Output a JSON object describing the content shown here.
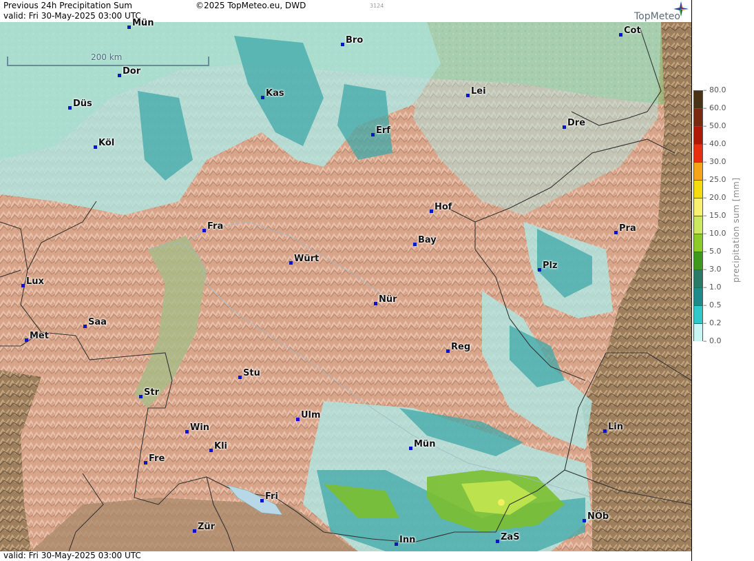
{
  "header": {
    "title": "Previous 24h Precipitation Sum",
    "valid": "valid:  Fri  30-May-2025 03:00 UTC",
    "copyright": "©2025 TopMeteo.eu, DWD",
    "code": "3124",
    "brand": "TopMeteo"
  },
  "footer": {
    "valid": "valid:  Fri  30-May-2025 03:00 UTC"
  },
  "scale": {
    "label": "200 km"
  },
  "legend": {
    "title": "precipitation sum  [mm]",
    "ticks": [
      "80.0",
      "60.0",
      "50.0",
      "40.0",
      "30.0",
      "25.0",
      "20.0",
      "15.0",
      "10.0",
      "5.0",
      "3.0",
      "1.0",
      "0.5",
      "0.2",
      "0.0"
    ],
    "colors": [
      "#4a3418",
      "#7a2a10",
      "#b01808",
      "#e83010",
      "#f6a418",
      "#f4dc10",
      "#f8f070",
      "#cbe860",
      "#8ccc28",
      "#3e9a1c",
      "#2a7a68",
      "#1e8a8a",
      "#30c8c8",
      "#c8f4f4",
      "#ffffff"
    ]
  },
  "cities": [
    {
      "name": "Mün"
    },
    {
      "name": "Bro"
    },
    {
      "name": "Cot"
    },
    {
      "name": "Dor"
    },
    {
      "name": "Kas"
    },
    {
      "name": "Lei"
    },
    {
      "name": "Düs"
    },
    {
      "name": "Erf"
    },
    {
      "name": "Dre"
    },
    {
      "name": "Köl"
    },
    {
      "name": "Hof"
    },
    {
      "name": "Fra"
    },
    {
      "name": "Pra"
    },
    {
      "name": "Bay"
    },
    {
      "name": "Würt"
    },
    {
      "name": "Plz"
    },
    {
      "name": "Lux"
    },
    {
      "name": "Nür"
    },
    {
      "name": "Saa"
    },
    {
      "name": "Met"
    },
    {
      "name": "Reg"
    },
    {
      "name": "Stu"
    },
    {
      "name": "Str"
    },
    {
      "name": "Ulm"
    },
    {
      "name": "Lin"
    },
    {
      "name": "Win"
    },
    {
      "name": "Kli"
    },
    {
      "name": "Mün"
    },
    {
      "name": "Fre"
    },
    {
      "name": "Fri"
    },
    {
      "name": "NÖb"
    },
    {
      "name": "Zür"
    },
    {
      "name": "ZaS"
    },
    {
      "name": "Inn"
    }
  ]
}
